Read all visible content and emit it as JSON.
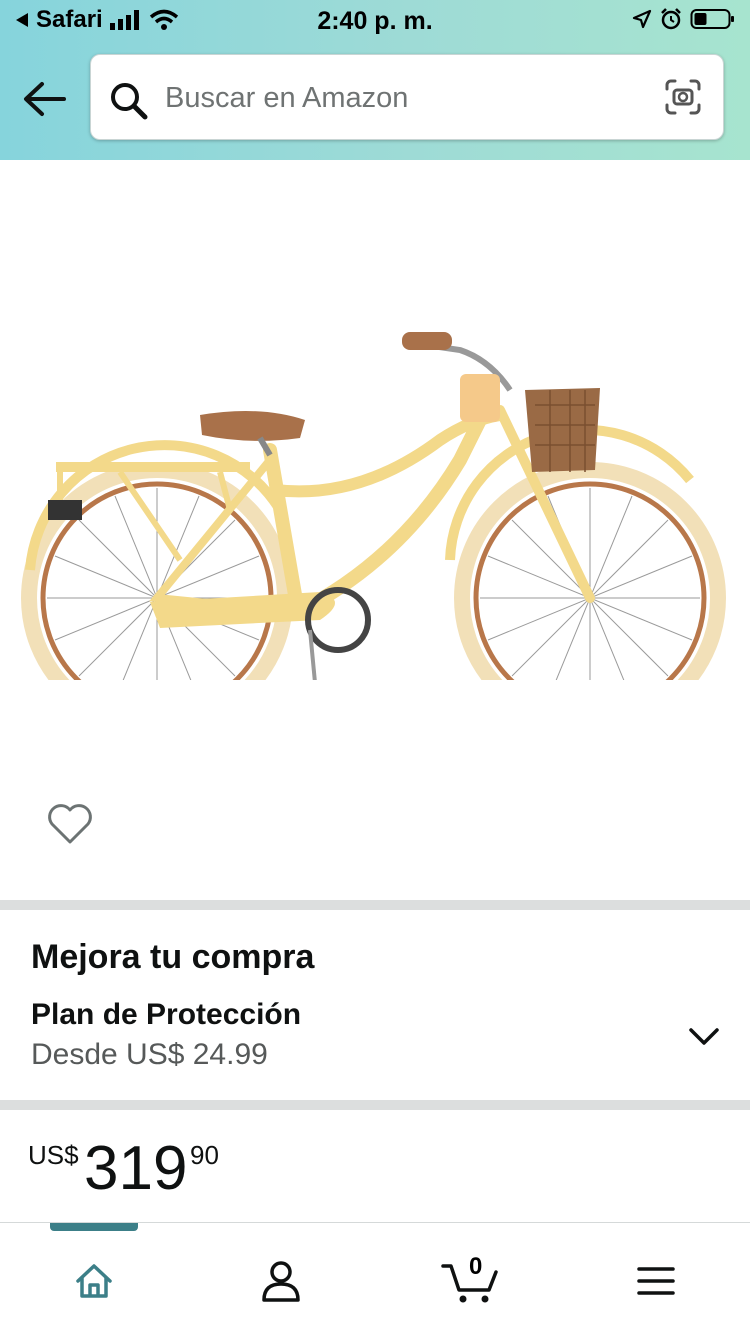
{
  "status_bar": {
    "back_app": "Safari",
    "time": "2:40 p. m."
  },
  "search": {
    "placeholder": "Buscar en Amazon",
    "value": ""
  },
  "product": {
    "image": "bicycle-image",
    "wishlist_icon": "heart-icon"
  },
  "upgrade": {
    "title": "Mejora tu compra",
    "plan": "Plan de Protección",
    "from": "Desde US$ 24.99"
  },
  "price": {
    "currency": "US$",
    "whole": "319",
    "fraction": "90"
  },
  "bottom_nav": {
    "items": [
      "home-icon",
      "account-icon",
      "cart-icon",
      "menu-icon"
    ],
    "cart_count": "0"
  },
  "colors": {
    "accent": "#3c7f88",
    "bike_frame": "#f3d98a",
    "tire": "#f2e0b8"
  }
}
